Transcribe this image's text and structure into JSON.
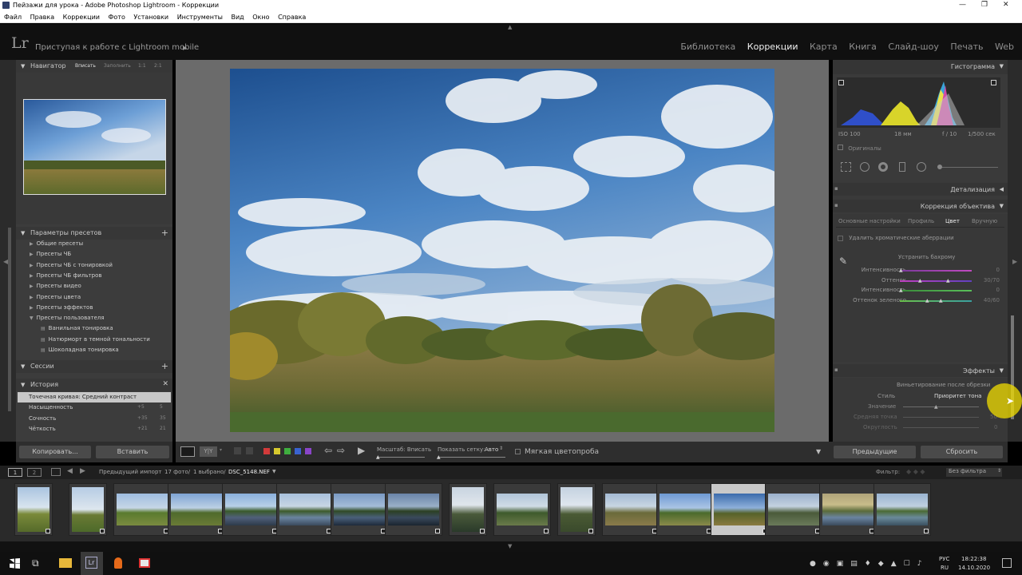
{
  "window": {
    "title": "Пейзажи для урока - Adobe Photoshop Lightroom - Коррекции"
  },
  "menu": [
    "Файл",
    "Правка",
    "Коррекции",
    "Фото",
    "Установки",
    "Инструменты",
    "Вид",
    "Окно",
    "Справка"
  ],
  "identity": {
    "logo": "Lr",
    "mobile_label": "Приступая к работе с Lightroom mobile"
  },
  "modules": [
    {
      "label": "Библиотека",
      "active": false
    },
    {
      "label": "Коррекции",
      "active": true
    },
    {
      "label": "Карта",
      "active": false
    },
    {
      "label": "Книга",
      "active": false
    },
    {
      "label": "Слайд-шоу",
      "active": false
    },
    {
      "label": "Печать",
      "active": false
    },
    {
      "label": "Web",
      "active": false
    }
  ],
  "navigator": {
    "title": "Навигатор",
    "zoom": [
      "Вписать",
      "Заполнить",
      "1:1",
      "2:1"
    ]
  },
  "presets": {
    "title": "Параметры пресетов",
    "items": [
      {
        "label": "Общие пресеты",
        "indent": 1,
        "icon": "triangle"
      },
      {
        "label": "Пресеты ЧБ",
        "indent": 1,
        "icon": "triangle"
      },
      {
        "label": "Пресеты ЧБ с тонировкой",
        "indent": 1,
        "icon": "triangle"
      },
      {
        "label": "Пресеты ЧБ фильтров",
        "indent": 1,
        "icon": "triangle"
      },
      {
        "label": "Пресеты видео",
        "indent": 1,
        "icon": "triangle"
      },
      {
        "label": "Пресеты цвета",
        "indent": 1,
        "icon": "triangle"
      },
      {
        "label": "Пресеты эффектов",
        "indent": 1,
        "icon": "triangle"
      },
      {
        "label": "Пресеты пользователя",
        "indent": 1,
        "icon": "triangle-open"
      },
      {
        "label": "Ванильная тонировка",
        "indent": 2,
        "icon": "doc"
      },
      {
        "label": "Натюрморт в темной тональности",
        "indent": 2,
        "icon": "doc"
      },
      {
        "label": "Шоколадная тонировка",
        "indent": 2,
        "icon": "doc"
      }
    ]
  },
  "sessions": {
    "title": "Сессии"
  },
  "history": {
    "title": "История",
    "items": [
      {
        "label": "Точечная кривая: Средний контраст",
        "a": "",
        "b": "",
        "selected": true
      },
      {
        "label": "Насыщенность",
        "a": "+5",
        "b": "5",
        "selected": false
      },
      {
        "label": "Сочность",
        "a": "+35",
        "b": "35",
        "selected": false
      },
      {
        "label": "Чёткость",
        "a": "+21",
        "b": "21",
        "selected": false
      }
    ]
  },
  "left_buttons": {
    "copy": "Копировать...",
    "paste": "Вставить"
  },
  "histogram": {
    "title": "Гистограмма",
    "iso": "ISO 100",
    "focal": "18 мм",
    "aperture": "f / 10",
    "shutter": "1/500 сек",
    "originals": "Оригиналы"
  },
  "detail": {
    "title": "Детализация"
  },
  "lens": {
    "title": "Коррекция объектива",
    "tabs": [
      {
        "label": "Основные настройки",
        "active": false
      },
      {
        "label": "Профиль",
        "active": false
      },
      {
        "label": "Цвет",
        "active": true
      },
      {
        "label": "Вручную",
        "active": false
      }
    ],
    "remove_ca": "Удалить хроматические аберрации",
    "defringe": "Устранить бахрому",
    "sliders": [
      {
        "label": "Интенсивность",
        "value": "0"
      },
      {
        "label": "Оттенок",
        "value": "30/70"
      },
      {
        "label": "Интенсивность",
        "value": "0"
      },
      {
        "label": "Оттенок зеленого",
        "value": "40/60"
      }
    ]
  },
  "effects": {
    "title": "Эффекты",
    "vignette": "Виньетирование после обрезки",
    "style_label": "Стиль",
    "style_value": "Приоритет тона",
    "rows": [
      {
        "label": "Значение",
        "value": ""
      },
      {
        "label": "Средняя точка",
        "value": "50"
      },
      {
        "label": "Округлость",
        "value": "0"
      }
    ]
  },
  "right_buttons": {
    "previous": "Предыдущие",
    "reset": "Сбросить"
  },
  "toolbar": {
    "zoom_label": "Масштаб: Вписать",
    "grid_label": "Показать сетку:",
    "grid_value": "Авто",
    "softproof": "Мягкая цветопроба",
    "colors": [
      "#d23a3a",
      "#d6c92e",
      "#3fae3f",
      "#3a63d0",
      "#8a45c8"
    ]
  },
  "filmbar": {
    "source": "Предыдущий импорт",
    "count": "17 фото/",
    "selected": "1 выбрано/",
    "file": "DSC_5148.NEF",
    "filter_label": "Фильтр:",
    "filter_value": "Без фильтра",
    "pages": [
      "1",
      "2"
    ]
  },
  "thumbs": [
    {
      "kind": "portrait",
      "selected": false
    },
    {
      "kind": "portrait",
      "selected": false
    },
    {
      "kind": "landscape",
      "selected": false
    },
    {
      "kind": "landscape",
      "selected": false
    },
    {
      "kind": "landscape",
      "selected": false
    },
    {
      "kind": "landscape",
      "selected": false
    },
    {
      "kind": "landscape",
      "selected": false
    },
    {
      "kind": "landscape",
      "selected": false
    },
    {
      "kind": "portrait",
      "selected": false
    },
    {
      "kind": "landscape",
      "selected": false
    },
    {
      "kind": "portrait",
      "selected": false
    },
    {
      "kind": "landscape",
      "selected": false
    },
    {
      "kind": "landscape",
      "selected": false
    },
    {
      "kind": "landscape",
      "selected": true
    },
    {
      "kind": "landscape",
      "selected": false
    },
    {
      "kind": "landscape",
      "selected": false
    },
    {
      "kind": "landscape",
      "selected": false
    }
  ],
  "taskbar": {
    "lang_a": "РУС",
    "lang_b": "RU",
    "time": "18:22:38",
    "date": "14.10.2020"
  }
}
